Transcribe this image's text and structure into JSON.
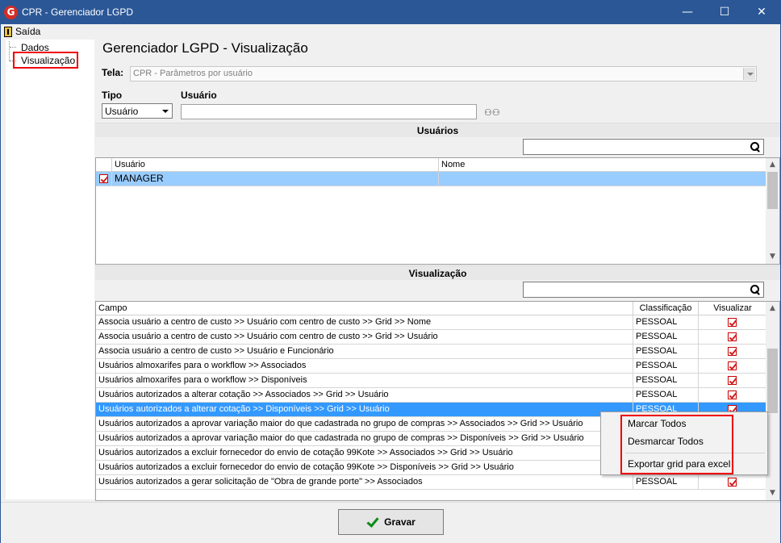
{
  "window": {
    "title": "CPR - Gerenciador LGPD",
    "app_icon": "G"
  },
  "menu": {
    "exit_label": "Saída"
  },
  "tree": {
    "items": [
      "Dados",
      "Visualização"
    ]
  },
  "page_title": "Gerenciador LGPD - Visualização",
  "tela": {
    "label": "Tela:",
    "value": "CPR - Parâmetros por usuário"
  },
  "tipo": {
    "label": "Tipo",
    "value": "Usuário"
  },
  "usuario_filter": {
    "label": "Usuário",
    "value": ""
  },
  "users_section": {
    "title": "Usuários",
    "search_value": "",
    "columns": [
      "Usuário",
      "Nome"
    ],
    "rows": [
      {
        "usuario": "MANAGER",
        "nome": "",
        "checked": true
      }
    ]
  },
  "visual_section": {
    "title": "Visualização",
    "search_value": "",
    "columns": [
      "Campo",
      "Classificação",
      "Visualizar"
    ],
    "rows": [
      {
        "campo": "Associa usuário a centro de custo >> Usuário com centro de custo >> Grid >> Nome",
        "classificacao": "PESSOAL",
        "visualizar": true
      },
      {
        "campo": "Associa usuário a centro de custo >> Usuário com centro de custo >> Grid >> Usuário",
        "classificacao": "PESSOAL",
        "visualizar": true
      },
      {
        "campo": "Associa usuário a centro de custo >> Usuário e Funcionário",
        "classificacao": "PESSOAL",
        "visualizar": true
      },
      {
        "campo": "Usuários almoxarifes para o workflow >> Associados",
        "classificacao": "PESSOAL",
        "visualizar": true
      },
      {
        "campo": "Usuários almoxarifes para o workflow >> Disponíveis",
        "classificacao": "PESSOAL",
        "visualizar": true
      },
      {
        "campo": "Usuários autorizados a alterar cotação >> Associados >> Grid >> Usuário",
        "classificacao": "PESSOAL",
        "visualizar": true
      },
      {
        "campo": "Usuários autorizados a alterar cotação >> Disponíveis >> Grid >> Usuário",
        "classificacao": "PESSOAL",
        "visualizar": true
      },
      {
        "campo": "Usuários autorizados a aprovar variação maior do que cadastrada no grupo de compras >> Associados >> Grid >> Usuário",
        "classificacao": "",
        "visualizar": false
      },
      {
        "campo": "Usuários autorizados a aprovar variação maior do que cadastrada no grupo de compras >> Disponíveis >> Grid >> Usuário",
        "classificacao": "",
        "visualizar": false
      },
      {
        "campo": "Usuários autorizados a excluir fornecedor do envio de cotação 99Kote >> Associados >> Grid >> Usuário",
        "classificacao": "",
        "visualizar": false
      },
      {
        "campo": "Usuários autorizados a excluir fornecedor do envio de cotação 99Kote >> Disponíveis >> Grid >> Usuário",
        "classificacao": "",
        "visualizar": false
      },
      {
        "campo": "Usuários autorizados a gerar solicitação de \"Obra de grande porte\" >> Associados",
        "classificacao": "PESSOAL",
        "visualizar": true
      }
    ],
    "selected_row": 6
  },
  "context_menu": {
    "items": [
      "Marcar Todos",
      "Desmarcar Todos",
      "Exportar grid para excel"
    ]
  },
  "footer": {
    "save_label": "Gravar"
  }
}
